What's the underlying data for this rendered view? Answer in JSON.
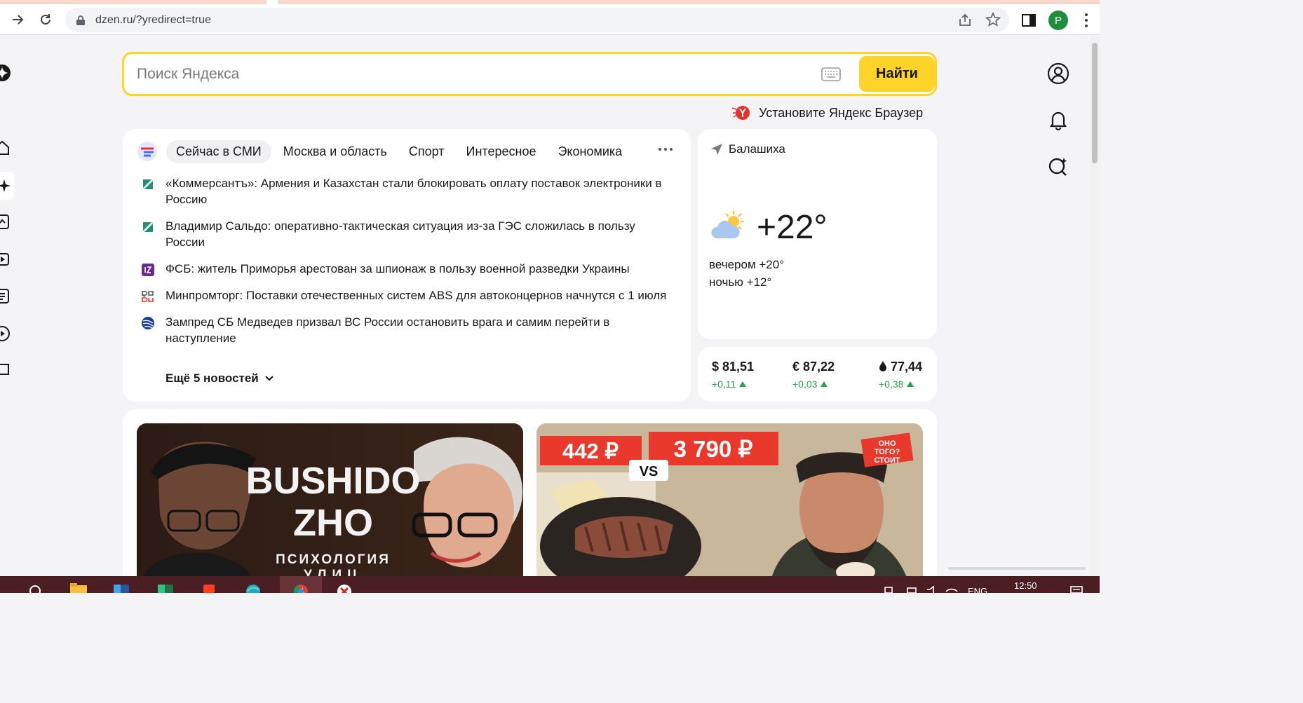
{
  "browser": {
    "url": "dzen.ru/?yredirect=true",
    "profile_initial": "P"
  },
  "search": {
    "placeholder": "Поиск Яндекса",
    "button_label": "Найти"
  },
  "promo": {
    "text": "Установите Яндекс Браузер"
  },
  "news": {
    "tabs": [
      {
        "label": "Сейчас в СМИ",
        "active": true
      },
      {
        "label": "Москва и область",
        "active": false
      },
      {
        "label": "Спорт",
        "active": false
      },
      {
        "label": "Интересное",
        "active": false
      },
      {
        "label": "Экономика",
        "active": false
      }
    ],
    "items": [
      {
        "text": "«Коммерсантъ»: Армения и Казахстан стали блокировать оплату поставок электроники в Россию",
        "source_icon": "kommersant-icon"
      },
      {
        "text": "Владимир Сальдо: оперативно-тактическая ситуация из-за ГЭС сложилась в пользу России",
        "source_icon": "kommersant-icon"
      },
      {
        "text": "ФСБ: житель Приморья арестован за шпионаж в пользу военной разведки Украины",
        "source_icon": "izvestia-icon"
      },
      {
        "text": "Минпромторг: Поставки отечественных систем ABS для автоконцернов начнутся с 1 июля",
        "source_icon": "rg-ru-icon"
      },
      {
        "text": "Зампред СБ Медведев призвал ВС России остановить врага и самим перейти в наступление",
        "source_icon": "globe-source-icon"
      }
    ],
    "more_label": "Ещё 5 новостей"
  },
  "weather": {
    "location": "Балашиха",
    "temperature": "+22°",
    "evening": "вечером +20°",
    "night": "ночью +12°",
    "icon": "partly-cloudy-icon"
  },
  "rates": [
    {
      "value": "$ 81,51",
      "change": "+0,11",
      "icon": "dollar"
    },
    {
      "value": "€ 87,22",
      "change": "+0,03",
      "icon": "euro"
    },
    {
      "value": "77,44",
      "change": "+0,38",
      "icon": "oil-drop-icon"
    }
  ],
  "feed": [
    {
      "title_line1": "BUSHIDO",
      "title_line2": "ZHO",
      "subtitle_line1": "ПСИХОЛОГИЯ",
      "subtitle_line2": "УЛИЦ"
    },
    {
      "price_left": "442 ₽",
      "price_right": "3 790 ₽",
      "vs": "VS",
      "badge_line1": "ОНО",
      "badge_line2": "ТОГО?",
      "badge_line3": "СТОИТ"
    }
  ],
  "taskbar": {
    "lang": "ENG",
    "time": "12:50"
  },
  "colors": {
    "accent_yellow": "#fed42b",
    "positive_green": "#2aa34a",
    "taskbar": "#4a1e22"
  }
}
